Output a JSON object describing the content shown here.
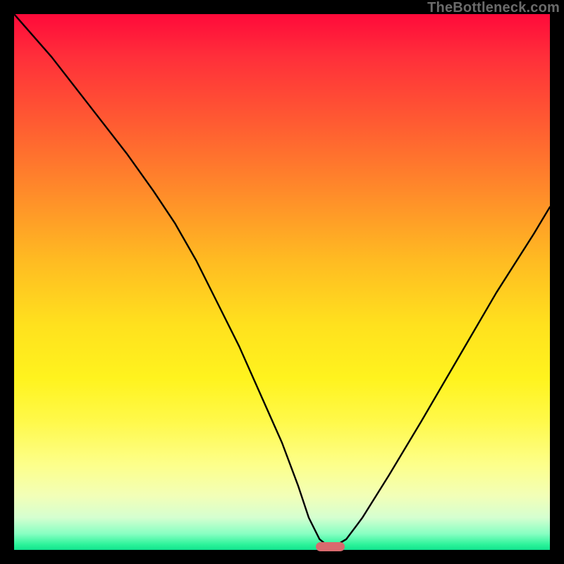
{
  "watermark": "TheBottleneck.com",
  "colors": {
    "frame_bg": "#000000",
    "marker": "#d96a6e",
    "curve": "#000000"
  },
  "chart_data": {
    "type": "line",
    "title": "",
    "xlabel": "",
    "ylabel": "",
    "xlim": [
      0,
      100
    ],
    "ylim": [
      0,
      100
    ],
    "grid": false,
    "legend": false,
    "series": [
      {
        "name": "bottleneck-curve",
        "x": [
          0,
          7,
          14,
          21,
          26,
          30,
          34,
          38,
          42,
          46,
          50,
          53,
          55,
          57,
          58.5,
          60,
          62,
          65,
          70,
          76,
          83,
          90,
          97,
          100
        ],
        "y": [
          100,
          92,
          83,
          74,
          67,
          61,
          54,
          46,
          38,
          29,
          20,
          12,
          6,
          2,
          0.8,
          0.8,
          2,
          6,
          14,
          24,
          36,
          48,
          59,
          64
        ]
      }
    ],
    "marker": {
      "x": 59,
      "y": 0.6,
      "width_pct": 5.5,
      "height_pct": 1.7
    },
    "gradient_stops": [
      {
        "pct": 0,
        "color": "#ff0a3a"
      },
      {
        "pct": 8,
        "color": "#ff2f3a"
      },
      {
        "pct": 20,
        "color": "#ff5a32"
      },
      {
        "pct": 33,
        "color": "#ff8a2a"
      },
      {
        "pct": 46,
        "color": "#ffbb22"
      },
      {
        "pct": 58,
        "color": "#ffe11e"
      },
      {
        "pct": 68,
        "color": "#fff31e"
      },
      {
        "pct": 76,
        "color": "#fff94a"
      },
      {
        "pct": 84,
        "color": "#fdff8a"
      },
      {
        "pct": 90,
        "color": "#f2ffb8"
      },
      {
        "pct": 94,
        "color": "#d4ffd0"
      },
      {
        "pct": 97,
        "color": "#87ffc2"
      },
      {
        "pct": 99,
        "color": "#2cf39a"
      },
      {
        "pct": 100,
        "color": "#12e28e"
      }
    ]
  }
}
